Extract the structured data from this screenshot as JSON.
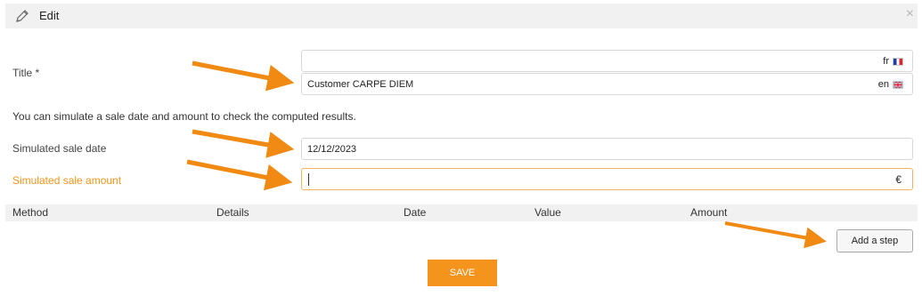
{
  "dialog": {
    "title": "Edit",
    "close_glyph": "×"
  },
  "form": {
    "title_label": "Title *",
    "title_fr_value": "",
    "title_fr_lang": "fr",
    "title_en_value": "Customer CARPE DIEM",
    "title_en_lang": "en",
    "info_text": "You can simulate a sale date and amount to check the computed results.",
    "sale_date_label": "Simulated sale date",
    "sale_date_value": "12/12/2023",
    "sale_amount_label": "Simulated sale amount",
    "sale_amount_value": "",
    "currency": "€"
  },
  "table": {
    "columns": [
      "Method",
      "Details",
      "Date",
      "Value",
      "Amount"
    ]
  },
  "buttons": {
    "add_step": "Add a step",
    "save": "SAVE"
  },
  "icons": {
    "edit": "pencil-icon",
    "close": "close-icon",
    "flag_fr": "flag-fr-icon",
    "flag_en": "flag-uk-icon"
  },
  "colors": {
    "accent": "#f5941c",
    "highlight_label": "#f39418",
    "header_bg": "#f1f1f1",
    "annotation_arrow": "#f08a12"
  }
}
